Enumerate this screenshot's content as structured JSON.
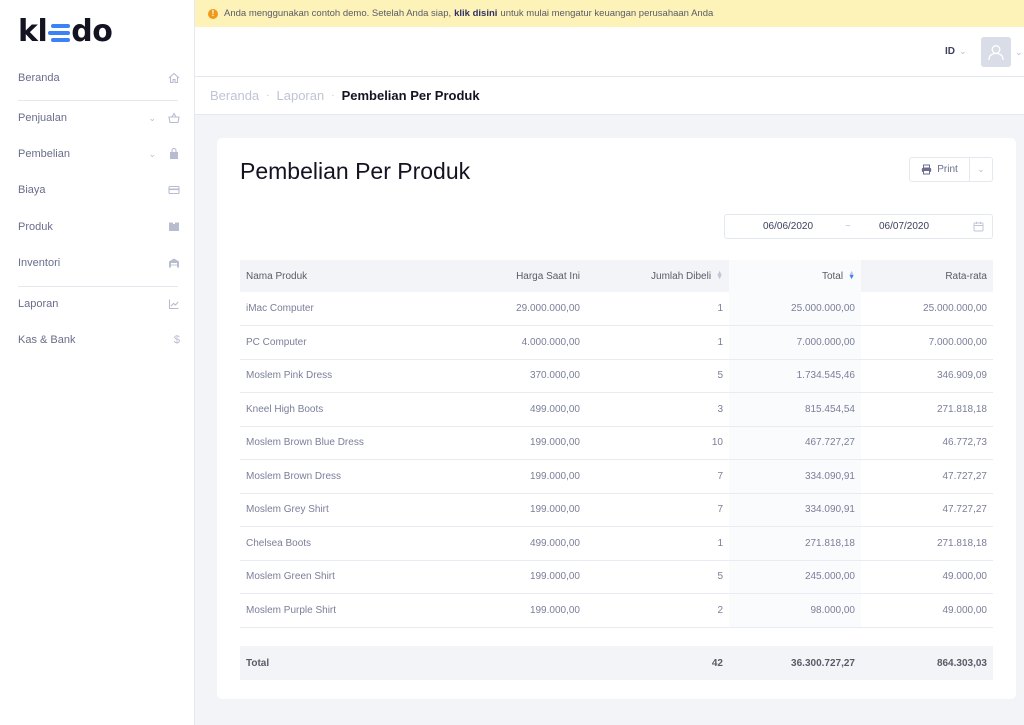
{
  "app": {
    "logo_text_left": "kl",
    "logo_text_right": "do",
    "logo_color": "#3b82f6"
  },
  "banner": {
    "text_before": "Anda menggunakan contoh demo. Setelah Anda siap,",
    "link": "klik disini",
    "text_after": "untuk mulai mengatur keuangan perusahaan Anda",
    "icon": "warning-icon",
    "background": "#fdf2b8"
  },
  "header": {
    "language": "ID"
  },
  "sidebar": {
    "items": [
      {
        "label": "Beranda",
        "icon": "home-icon"
      },
      {
        "label": "Penjualan",
        "icon": "basket-icon"
      },
      {
        "label": "Pembelian",
        "icon": "bag-icon"
      },
      {
        "label": "Biaya",
        "icon": "card-icon"
      },
      {
        "label": "Produk",
        "icon": "box-icon"
      },
      {
        "label": "Inventori",
        "icon": "warehouse-icon"
      },
      {
        "label": "Laporan",
        "icon": "chart-icon"
      },
      {
        "label": "Kas & Bank",
        "icon": "dollar-icon"
      }
    ]
  },
  "breadcrumb": {
    "home": "Beranda",
    "parent": "Laporan",
    "current": "Pembelian Per Produk"
  },
  "page": {
    "title": "Pembelian Per Produk",
    "print_label": "Print",
    "date_from": "06/06/2020",
    "date_separator": "~",
    "date_to": "06/07/2020"
  },
  "table": {
    "headers": {
      "name": "Nama Produk",
      "price": "Harga Saat Ini",
      "qty": "Jumlah Dibeli",
      "total": "Total",
      "avg": "Rata-rata"
    },
    "rows": [
      {
        "name": "iMac Computer",
        "price": "29.000.000,00",
        "qty": "1",
        "total": "25.000.000,00",
        "avg": "25.000.000,00"
      },
      {
        "name": "PC Computer",
        "price": "4.000.000,00",
        "qty": "1",
        "total": "7.000.000,00",
        "avg": "7.000.000,00"
      },
      {
        "name": "Moslem Pink Dress",
        "price": "370.000,00",
        "qty": "5",
        "total": "1.734.545,46",
        "avg": "346.909,09"
      },
      {
        "name": "Kneel High Boots",
        "price": "499.000,00",
        "qty": "3",
        "total": "815.454,54",
        "avg": "271.818,18"
      },
      {
        "name": "Moslem Brown Blue Dress",
        "price": "199.000,00",
        "qty": "10",
        "total": "467.727,27",
        "avg": "46.772,73"
      },
      {
        "name": "Moslem Brown Dress",
        "price": "199.000,00",
        "qty": "7",
        "total": "334.090,91",
        "avg": "47.727,27"
      },
      {
        "name": "Moslem Grey Shirt",
        "price": "199.000,00",
        "qty": "7",
        "total": "334.090,91",
        "avg": "47.727,27"
      },
      {
        "name": "Chelsea Boots",
        "price": "499.000,00",
        "qty": "1",
        "total": "271.818,18",
        "avg": "271.818,18"
      },
      {
        "name": "Moslem Green Shirt",
        "price": "199.000,00",
        "qty": "5",
        "total": "245.000,00",
        "avg": "49.000,00"
      },
      {
        "name": "Moslem Purple Shirt",
        "price": "199.000,00",
        "qty": "2",
        "total": "98.000,00",
        "avg": "49.000,00"
      }
    ],
    "footer": {
      "label": "Total",
      "qty": "42",
      "total": "36.300.727,27",
      "avg": "864.303,03"
    }
  }
}
